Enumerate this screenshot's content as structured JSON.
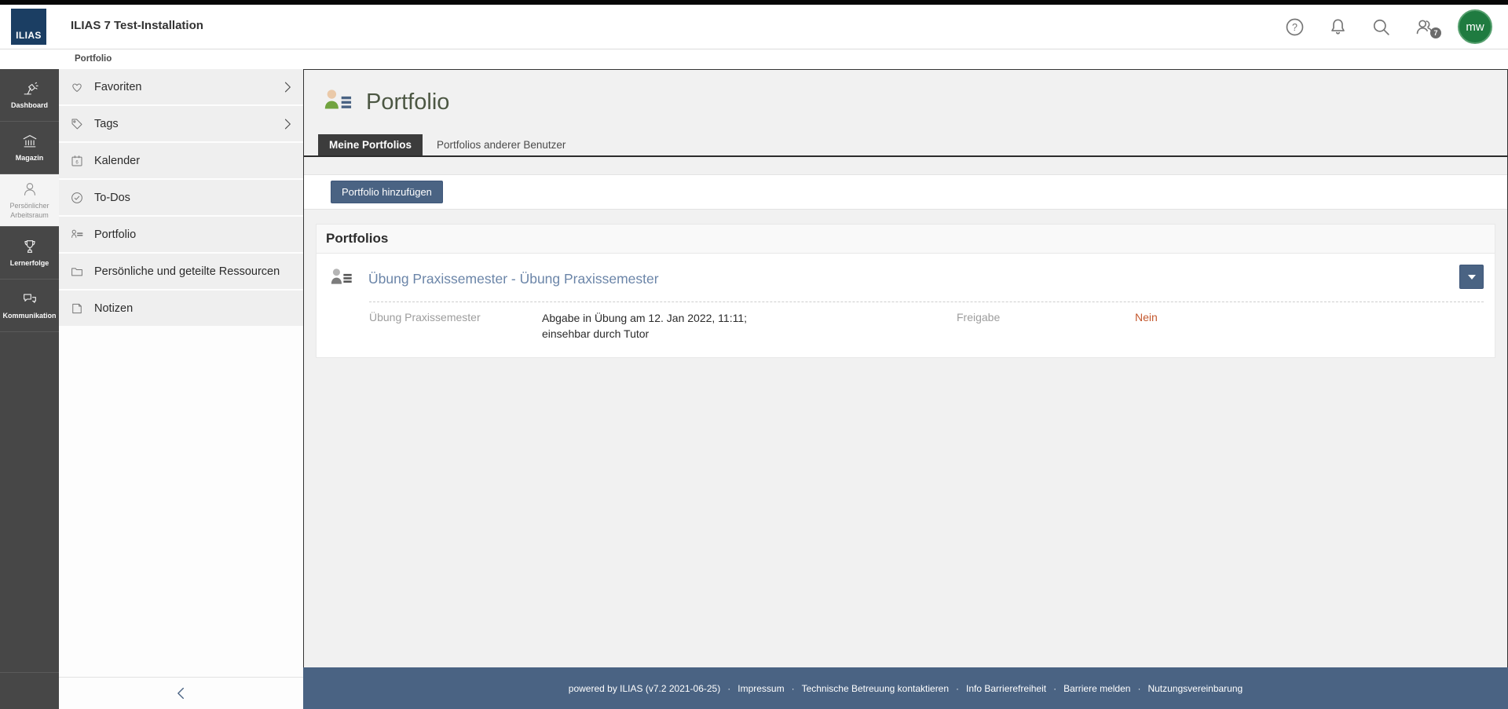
{
  "topbar": {
    "logo_text": "ILIAS",
    "title": "ILIAS 7 Test-Installation",
    "online_count": "7",
    "avatar_initials": "mw"
  },
  "breadcrumb": {
    "label": "Portfolio"
  },
  "rail": {
    "items": [
      {
        "label": "Dashboard"
      },
      {
        "label": "Magazin"
      },
      {
        "label": "Persönlicher Arbeitsraum"
      },
      {
        "label": "Lernerfolge"
      },
      {
        "label": "Kommunikation"
      }
    ]
  },
  "sidebar": {
    "items": [
      {
        "label": "Favoriten"
      },
      {
        "label": "Tags"
      },
      {
        "label": "Kalender"
      },
      {
        "label": "To-Dos"
      },
      {
        "label": "Portfolio"
      },
      {
        "label": "Persönliche und geteilte Ressourcen"
      },
      {
        "label": "Notizen"
      }
    ]
  },
  "main": {
    "page_title": "Portfolio",
    "tabs": [
      {
        "label": "Meine Portfolios"
      },
      {
        "label": "Portfolios anderer Benutzer"
      }
    ],
    "add_button": "Portfolio hinzufügen",
    "section_title": "Portfolios",
    "portfolio": {
      "title": "Übung Praxissemester - Übung Praxissemester",
      "detail_label": "Übung Praxissemester",
      "detail_value": "Abgabe in Übung am 12. Jan 2022, 11:11; einsehbar durch Tutor",
      "share_label": "Freigabe",
      "share_value": "Nein"
    }
  },
  "footer": {
    "powered_by": "powered by ILIAS (v7.2 2021-06-25)",
    "separator": "·",
    "links": [
      "Impressum",
      "Technische Betreuung kontaktieren",
      "Info Barrierefreiheit",
      "Barriere melden",
      "Nutzungsvereinbarung"
    ]
  },
  "colors": {
    "accent_slate": "#4a6383",
    "logo_navy": "#1b3e63",
    "avatar_green": "#1f7b40",
    "link_blue": "#6b85a8",
    "warning_orange": "#c4582e",
    "rail_dark": "#474747"
  }
}
